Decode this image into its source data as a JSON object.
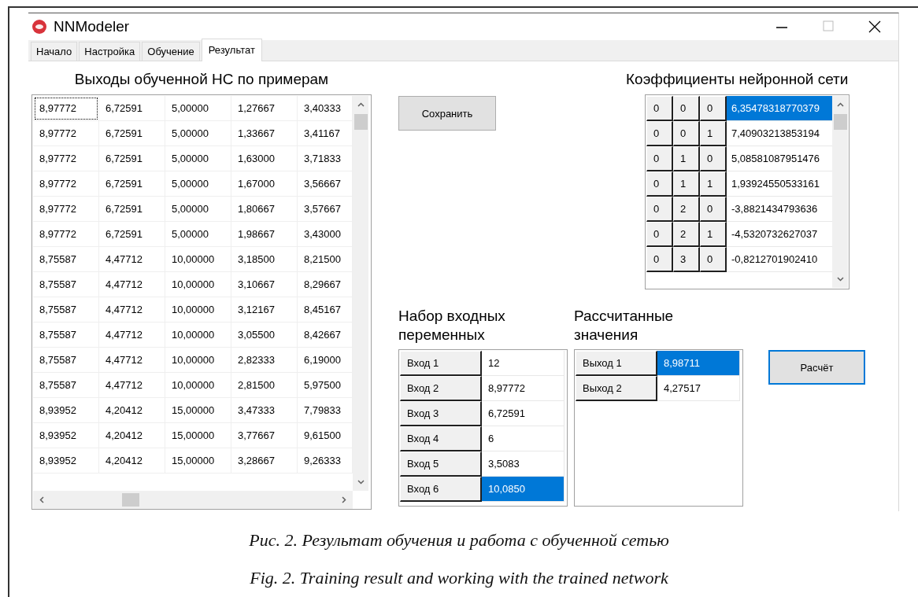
{
  "window": {
    "title": "NNModeler"
  },
  "tabs": [
    {
      "label": "Начало",
      "selected": false
    },
    {
      "label": "Настройка",
      "selected": false
    },
    {
      "label": "Обучение",
      "selected": false
    },
    {
      "label": "Результат",
      "selected": true
    }
  ],
  "outputs_table": {
    "title": "Выходы обученной НС по примерам",
    "rows": [
      {
        "focused": true,
        "cells": [
          "8,97772",
          "6,72591",
          "5,00000",
          "1,27667",
          "3,40333"
        ]
      },
      {
        "focused": false,
        "cells": [
          "8,97772",
          "6,72591",
          "5,00000",
          "1,33667",
          "3,41167"
        ]
      },
      {
        "focused": false,
        "cells": [
          "8,97772",
          "6,72591",
          "5,00000",
          "1,63000",
          "3,71833"
        ]
      },
      {
        "focused": false,
        "cells": [
          "8,97772",
          "6,72591",
          "5,00000",
          "1,67000",
          "3,56667"
        ]
      },
      {
        "focused": false,
        "cells": [
          "8,97772",
          "6,72591",
          "5,00000",
          "1,80667",
          "3,57667"
        ]
      },
      {
        "focused": false,
        "cells": [
          "8,97772",
          "6,72591",
          "5,00000",
          "1,98667",
          "3,43000"
        ]
      },
      {
        "focused": false,
        "cells": [
          "8,75587",
          "4,47712",
          "10,00000",
          "3,18500",
          "8,21500"
        ]
      },
      {
        "focused": false,
        "cells": [
          "8,75587",
          "4,47712",
          "10,00000",
          "3,10667",
          "8,29667"
        ]
      },
      {
        "focused": false,
        "cells": [
          "8,75587",
          "4,47712",
          "10,00000",
          "3,12167",
          "8,45167"
        ]
      },
      {
        "focused": false,
        "cells": [
          "8,75587",
          "4,47712",
          "10,00000",
          "3,05500",
          "8,42667"
        ]
      },
      {
        "focused": false,
        "cells": [
          "8,75587",
          "4,47712",
          "10,00000",
          "2,82333",
          "6,19000"
        ]
      },
      {
        "focused": false,
        "cells": [
          "8,75587",
          "4,47712",
          "10,00000",
          "2,81500",
          "5,97500"
        ]
      },
      {
        "focused": false,
        "cells": [
          "8,93952",
          "4,20412",
          "15,00000",
          "3,47333",
          "7,79833"
        ]
      },
      {
        "focused": false,
        "cells": [
          "8,93952",
          "4,20412",
          "15,00000",
          "3,77667",
          "9,61500"
        ]
      },
      {
        "focused": false,
        "cells": [
          "8,93952",
          "4,20412",
          "15,00000",
          "3,28667",
          "9,26333"
        ]
      }
    ]
  },
  "save_button": "Сохранить",
  "coefficients": {
    "title": "Коэффициенты нейронной сети",
    "rows": [
      {
        "indices": [
          "0",
          "0",
          "0"
        ],
        "value": "6,35478318770379",
        "selected": true
      },
      {
        "indices": [
          "0",
          "0",
          "1"
        ],
        "value": "7,40903213853194",
        "selected": false
      },
      {
        "indices": [
          "0",
          "1",
          "0"
        ],
        "value": "5,08581087951476",
        "selected": false
      },
      {
        "indices": [
          "0",
          "1",
          "1"
        ],
        "value": "1,93924550533161",
        "selected": false
      },
      {
        "indices": [
          "0",
          "2",
          "0"
        ],
        "value": "-3,8821434793636",
        "selected": false
      },
      {
        "indices": [
          "0",
          "2",
          "1"
        ],
        "value": "-4,5320732627037",
        "selected": false
      },
      {
        "indices": [
          "0",
          "3",
          "0"
        ],
        "value": "-0,8212701902410",
        "selected": false
      }
    ]
  },
  "inputs": {
    "title": "Набор входных переменных",
    "rows": [
      {
        "label": "Вход 1",
        "value": "12",
        "selected": false
      },
      {
        "label": "Вход 2",
        "value": "8,97772",
        "selected": false
      },
      {
        "label": "Вход 3",
        "value": "6,72591",
        "selected": false
      },
      {
        "label": "Вход 4",
        "value": "6",
        "selected": false
      },
      {
        "label": "Вход 5",
        "value": "3,5083",
        "selected": false
      },
      {
        "label": "Вход 6",
        "value": "10,0850",
        "selected": true
      }
    ]
  },
  "results": {
    "title": "Рассчитанные значения",
    "rows": [
      {
        "label": "Выход 1",
        "value": "8,98711",
        "selected": true
      },
      {
        "label": "Выход 2",
        "value": "4,27517",
        "selected": false
      }
    ]
  },
  "calc_button": "Расчёт",
  "captions": [
    "Рис. 2. Результат обучения и работа с обученной сетью",
    "Fig. 2. Training result and working with the trained network"
  ]
}
